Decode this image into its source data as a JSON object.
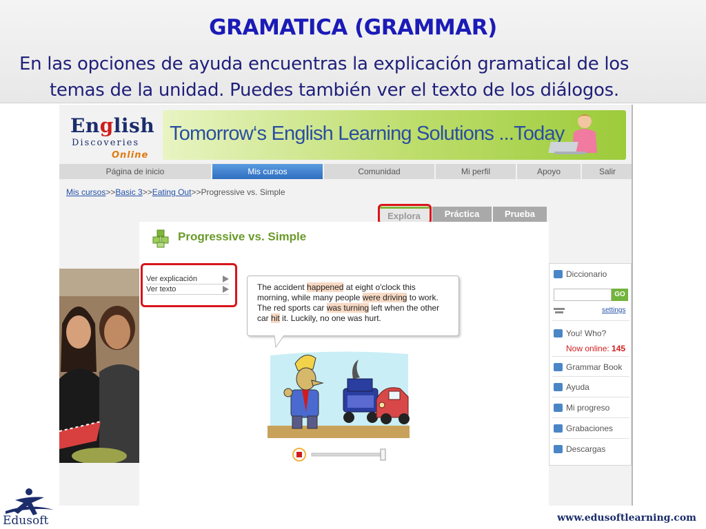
{
  "slide": {
    "title": "GRAMATICA (GRAMMAR)",
    "body": "En las opciones de ayuda encuentras la explicación gramatical de los temas de la unidad. Puedes también ver el texto de los diálogos."
  },
  "site": {
    "logo_word_en": "En",
    "logo_word_g": "g",
    "logo_word_rest": "lish",
    "logo_line2": "Discoveries",
    "logo_line3": "Online",
    "banner_text": "Tomorrow‘s English Learning Solutions ...Today"
  },
  "nav": {
    "items": [
      "Página de inicio",
      "Mis cursos",
      "Comunidad",
      "Mi perfil",
      "Apoyo",
      "Salir"
    ],
    "active": "Mis cursos"
  },
  "breadcrumb": {
    "links": [
      "Mis cursos",
      "Basic 3",
      "Eating Out"
    ],
    "current": "Progressive vs. Simple",
    "separator": ">>"
  },
  "tabs": [
    "Explora",
    "Práctica",
    "Prueba"
  ],
  "lesson": {
    "title": "Progressive vs. Simple",
    "options": [
      "Ver explicación",
      "Ver texto"
    ],
    "dialog": {
      "p1": "The accident ",
      "h1": "happened",
      "p2": " at eight o'clock this morning, while many people ",
      "h2": "were driving",
      "p3": " to work. The red sports car ",
      "h3": "was turning",
      "p4": " left when the other car ",
      "h4": "hit",
      "p5": " it. Luckily, no one was hurt."
    }
  },
  "sidebar": {
    "diccionario": "Diccionario",
    "go": "GO",
    "settings": "settings",
    "you_who": "You! Who?",
    "now_online_label": "Now online:",
    "now_online_count": "145",
    "items": [
      "Grammar Book",
      "Ayuda",
      "Mi progreso",
      "Grabaciones",
      "Descargas"
    ]
  },
  "footer": {
    "brand": "Edusoft",
    "url": "www.edusoftlearning.com"
  },
  "colors": {
    "title": "#1b1bb8",
    "body_text": "#1f1f7a",
    "highlight_box": "#d8141a",
    "active_nav": "#2e6fc0",
    "lesson_title": "#6a9a2a"
  }
}
